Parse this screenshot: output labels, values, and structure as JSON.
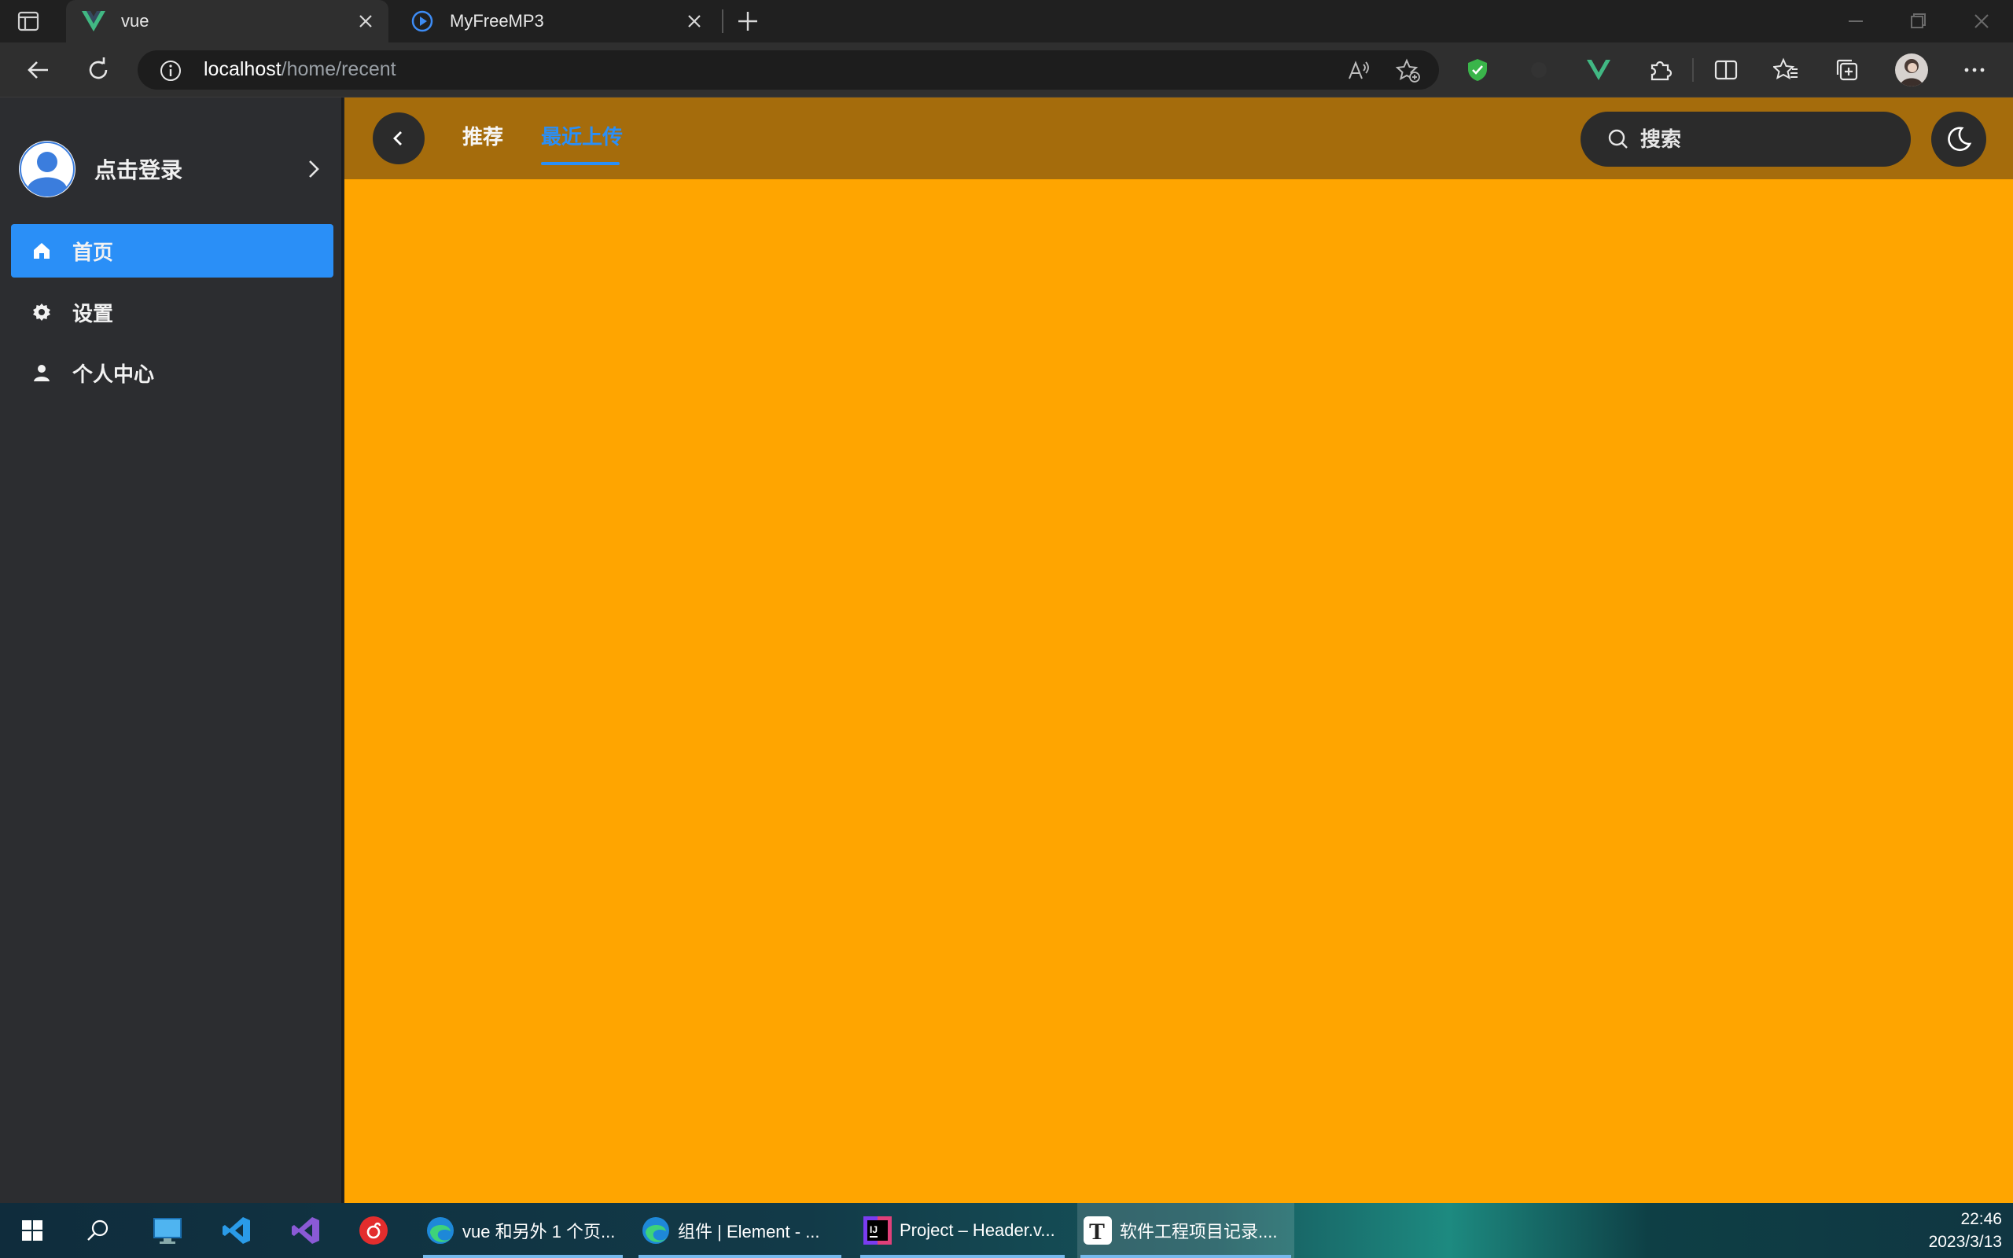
{
  "browser": {
    "tabs": [
      {
        "title": "vue",
        "active": true
      },
      {
        "title": "MyFreeMP3",
        "active": false
      }
    ],
    "address": {
      "host": "localhost",
      "path": "/home/recent"
    },
    "accent": "#2a8ff7"
  },
  "sidebar": {
    "login_label": "点击登录",
    "items": [
      {
        "label": "首页",
        "icon": "home-icon",
        "active": true
      },
      {
        "label": "设置",
        "icon": "gear-icon",
        "active": false
      },
      {
        "label": "个人中心",
        "icon": "user-icon",
        "active": false
      }
    ]
  },
  "header": {
    "tabs": [
      {
        "label": "推荐",
        "active": false
      },
      {
        "label": "最近上传",
        "active": true
      }
    ],
    "search_placeholder": "搜索"
  },
  "colors": {
    "main_bg": "#ffa500",
    "header_bg": "#a56c0c",
    "sidebar_bg": "#2c2d30"
  },
  "taskbar": {
    "apps": [
      {
        "label": "vue 和另外 1 个页...",
        "icon": "edge-icon"
      },
      {
        "label": "组件 | Element - ...",
        "icon": "edge-icon"
      },
      {
        "label": "Project – Header.v...",
        "icon": "intellij-icon"
      },
      {
        "label": "软件工程项目记录....",
        "icon": "typora-icon"
      }
    ],
    "time": "22:46",
    "date": "2023/3/13"
  }
}
